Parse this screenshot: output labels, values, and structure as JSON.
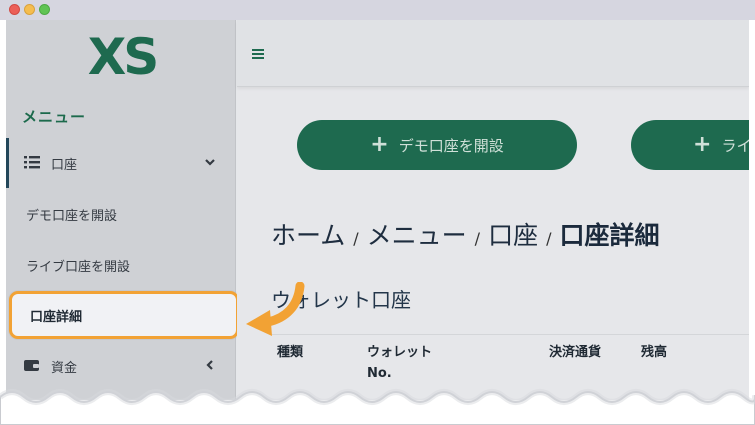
{
  "sidebar": {
    "logo_text": "XS",
    "menu_heading": "メニュー",
    "items": [
      {
        "label": "口座",
        "icon": "list-icon",
        "chevron": "chevron-down-icon"
      },
      {
        "label": "デモ口座を開設"
      },
      {
        "label": "ライブ口座を開設"
      },
      {
        "label": "口座詳細"
      },
      {
        "label": "資金",
        "icon": "wallet-icon",
        "chevron": "chevron-left-icon"
      }
    ]
  },
  "topbar": {
    "menu_icon": "hamburger-icon"
  },
  "main": {
    "buttons": {
      "demo": {
        "plus": "+",
        "label": "デモ口座を開設"
      },
      "live": {
        "plus": "+",
        "label": "ライ"
      }
    },
    "breadcrumb": [
      {
        "label": "ホーム"
      },
      {
        "label": "メニュー"
      },
      {
        "label": "口座"
      },
      {
        "label": "口座詳細"
      }
    ],
    "breadcrumb_separator": "/",
    "section_title": "ウォレット口座",
    "table_headers": [
      "種類",
      "ウォレット\nNo.",
      "決済通貨",
      "残高"
    ]
  },
  "colors": {
    "brand_green": "#1e6a4f",
    "highlight_border": "#f2a234",
    "arrow": "#f2a234"
  }
}
